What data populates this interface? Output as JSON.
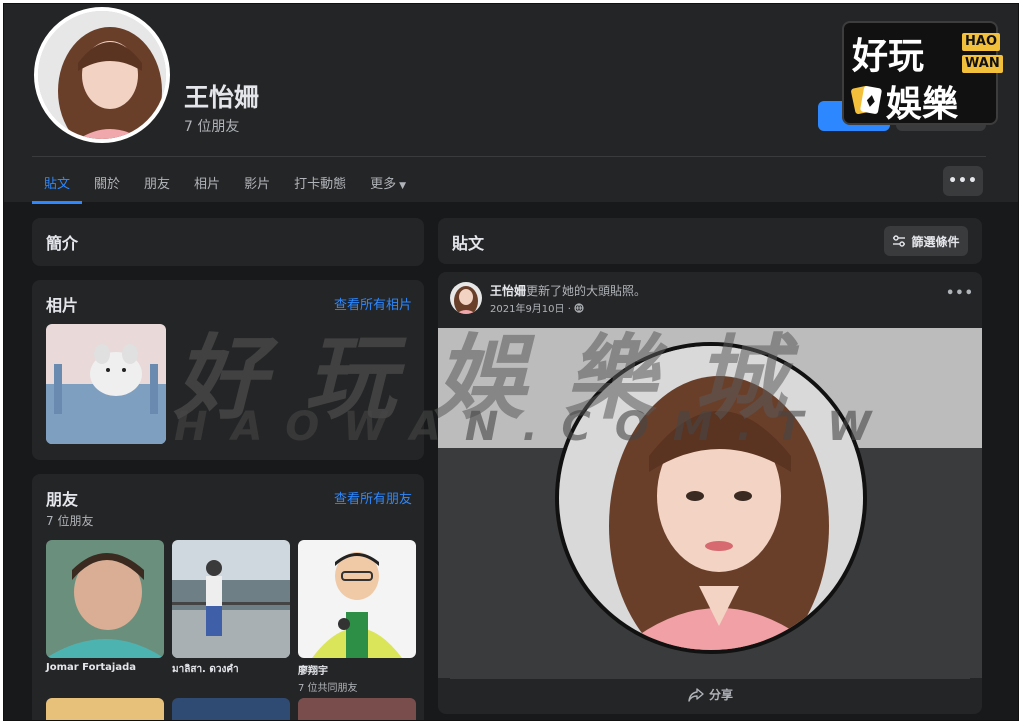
{
  "profile": {
    "name": "王怡姍",
    "friend_count": "7 位朋友"
  },
  "logo": {
    "line1": "好玩",
    "line2": "娛樂",
    "tag1": "HAO",
    "tag2": "WAN"
  },
  "tabs": [
    {
      "label": "貼文",
      "active": true
    },
    {
      "label": "關於"
    },
    {
      "label": "朋友"
    },
    {
      "label": "相片"
    },
    {
      "label": "影片"
    },
    {
      "label": "打卡動態"
    },
    {
      "label": "更多"
    }
  ],
  "more_caret": "▼",
  "dots": "•••",
  "intro": {
    "title": "簡介"
  },
  "photos": {
    "title": "相片",
    "link": "查看所有相片"
  },
  "friends": {
    "title": "朋友",
    "count": "7 位朋友",
    "link": "查看所有朋友",
    "items": [
      {
        "name": "Jomar Fortajada",
        "mutual": ""
      },
      {
        "name": "มาลิสา. ดวงคำ",
        "mutual": ""
      },
      {
        "name": "廖翔宇",
        "mutual": "7 位共同朋友"
      }
    ]
  },
  "posts": {
    "title": "貼文",
    "filter_label": "篩選條件",
    "post": {
      "author": "王怡姍",
      "action": "更新了她的大頭貼照。",
      "date": "2021年9月10日 ·",
      "share_label": "分享"
    }
  },
  "watermark": {
    "big": "好玩娛樂城",
    "small": "HAOWAN.COM.TW"
  },
  "colors": {
    "accent": "#2d88ff",
    "background": "#18191a",
    "card": "#242526"
  }
}
